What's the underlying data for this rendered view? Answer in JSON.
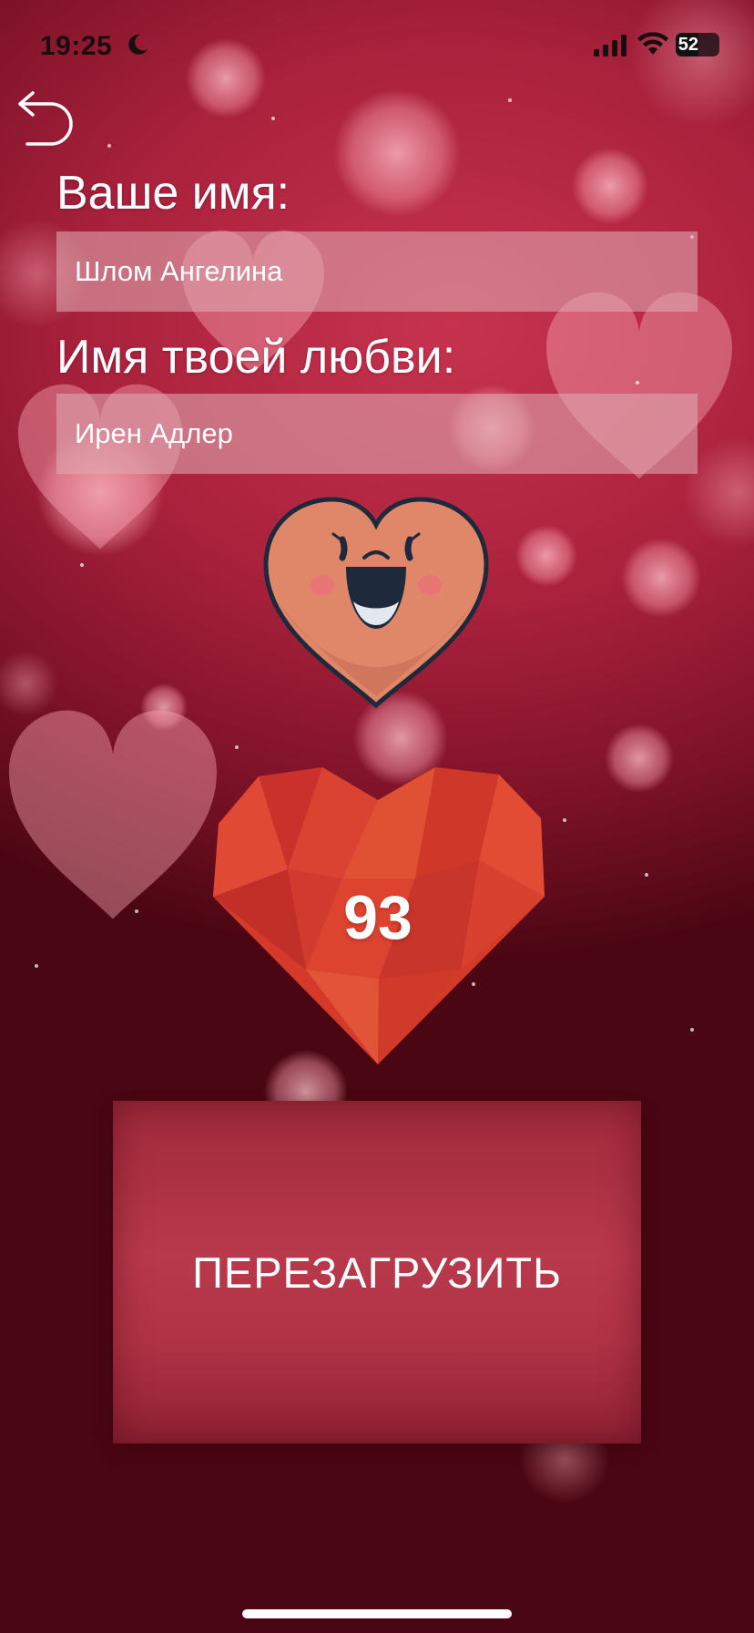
{
  "status_bar": {
    "time": "19:25",
    "moon_icon": "moon-icon",
    "signal_icon": "cellular-signal-icon",
    "wifi_icon": "wifi-icon",
    "battery_level": "52"
  },
  "nav": {
    "back_icon": "back-arrow-icon"
  },
  "form": {
    "your_name_label": "Ваше имя:",
    "your_name_value": "Шлом Ангелина",
    "love_name_label": "Имя твоей любви:",
    "love_name_value": "Ирен Адлер"
  },
  "result": {
    "face_icon": "smiling-heart-icon",
    "heart_icon": "polygon-heart-icon",
    "score": "93"
  },
  "actions": {
    "reload_label": "ПЕРЕЗАГРУЗИТЬ"
  },
  "colors": {
    "background": "#a9213c",
    "accent": "#b8394b",
    "heart_red": "#d63a2b",
    "heart_face": "#e0856a"
  }
}
